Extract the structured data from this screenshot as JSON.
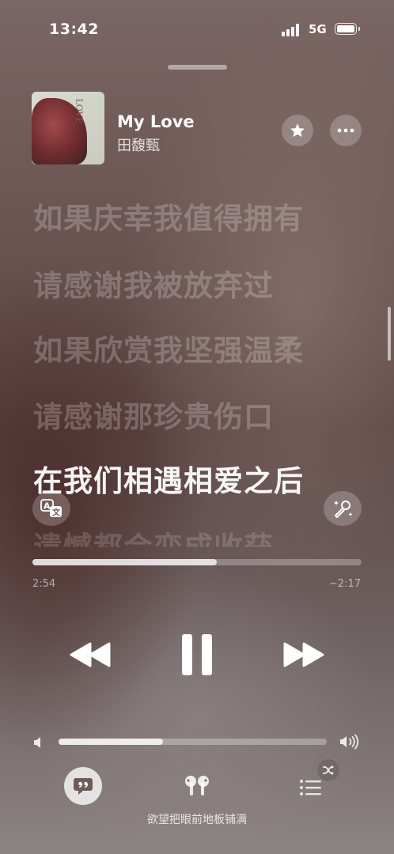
{
  "status_bar": {
    "time": "13:42",
    "network": "5G"
  },
  "now_playing": {
    "title": "My Love",
    "artist": "田馥甄"
  },
  "album_art": {
    "text": "LOVE"
  },
  "lyrics": [
    {
      "text": "如果庆幸我值得拥有",
      "state": "past"
    },
    {
      "text": "请感谢我被放弃过",
      "state": "past"
    },
    {
      "text": "如果欣赏我坚强温柔",
      "state": "past"
    },
    {
      "text": "请感谢那珍贵伤口",
      "state": "past"
    },
    {
      "text": "在我们相遇相爱之后",
      "state": "current"
    },
    {
      "text": "遗憾都会变成收获",
      "state": "upcoming"
    }
  ],
  "playback": {
    "elapsed": "2:54",
    "remaining": "−2:17",
    "progress": 0.56
  },
  "volume": {
    "level": 0.39
  },
  "icons": [
    "star-icon",
    "more-icon",
    "translate-icon",
    "sing-mic-icon",
    "rewind-icon",
    "pause-icon",
    "forward-icon",
    "volume-low-icon",
    "volume-high-icon",
    "lyrics-quote-icon",
    "airpods-icon",
    "queue-list-icon",
    "shuffle-icon"
  ],
  "caption": "欲望把眼前地板铺满"
}
